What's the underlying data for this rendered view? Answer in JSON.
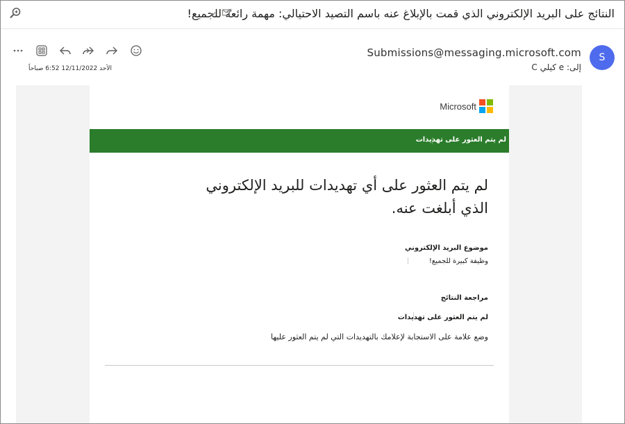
{
  "subject": {
    "title": "النتائج على البريد الإلكتروني الذي قمت بالإبلاغ عنه باسم التصيد الاحتيالي: مهمة رائعة للجميع!"
  },
  "sender": {
    "avatar_letter": "S",
    "address": "Submissions@messaging.microsoft.com",
    "recipient_label": "إلى:",
    "recipient_name": "e كيلي C",
    "sent_datetime": "الأحد 12/11/2022 6:52 صباحاً"
  },
  "toolbar": {
    "icons": [
      "emoji-icon",
      "reply-icon",
      "reply-all-icon",
      "forward-icon",
      "apps-icon",
      "more-icon"
    ]
  },
  "email": {
    "brand": "Microsoft",
    "brand_colors": [
      "#f25022",
      "#7fba00",
      "#00a4ef",
      "#ffb900"
    ],
    "banner_text": "لم يتم العثور على تهديدات",
    "banner_color": "#2b7d2b",
    "headline": "لم يتم العثور على أي تهديدات للبريد الإلكتروني الذي أبلغت عنه.",
    "subject_label": "موضوع البريد الإلكتروني",
    "subject_value": "وظيفة كبيرة للجميع!",
    "review_label": "مراجعة النتائج",
    "review_value": "لم يتم العثور على تهديدات",
    "review_note": "وضع علامة على الاستجابة لإعلامك بالتهديدات التي لم يتم العثور عليها"
  }
}
